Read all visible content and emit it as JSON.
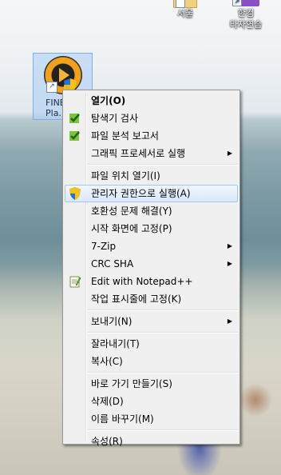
{
  "desktop": {
    "icons": [
      {
        "name": "서울",
        "icon": "folder-icon"
      },
      {
        "name": "한컴\n타자연습",
        "icon": "typing-app-icon"
      }
    ],
    "selected_icon": {
      "name": "FINE\nPla...",
      "icon": "media-player-icon"
    }
  },
  "context_menu": {
    "items": [
      {
        "label": "열기(O)",
        "bold": true
      },
      {
        "label": "탐색기 검사",
        "icon": "scan-icon"
      },
      {
        "label": "파일 분석 보고서",
        "icon": "scan-icon"
      },
      {
        "label": "그래픽 프로세서로 실행",
        "submenu": true
      },
      {
        "label": "파일 위치 열기(I)"
      },
      {
        "label": "관리자 권한으로 실행(A)",
        "icon": "shield-icon",
        "highlighted": true
      },
      {
        "label": "호환성 문제 해결(Y)"
      },
      {
        "label": "시작 화면에 고정(P)"
      },
      {
        "label": "7-Zip",
        "submenu": true
      },
      {
        "label": "CRC SHA",
        "submenu": true
      },
      {
        "label": "Edit with Notepad++",
        "icon": "notepad-icon"
      },
      {
        "label": "작업 표시줄에 고정(K)"
      },
      {
        "label": "보내기(N)",
        "submenu": true
      },
      {
        "label": "잘라내기(T)"
      },
      {
        "label": "복사(C)"
      },
      {
        "label": "바로 가기 만들기(S)"
      },
      {
        "label": "삭제(D)"
      },
      {
        "label": "이름 바꾸기(M)"
      },
      {
        "label": "속성(R)"
      }
    ],
    "submenu_glyph": "▶"
  }
}
